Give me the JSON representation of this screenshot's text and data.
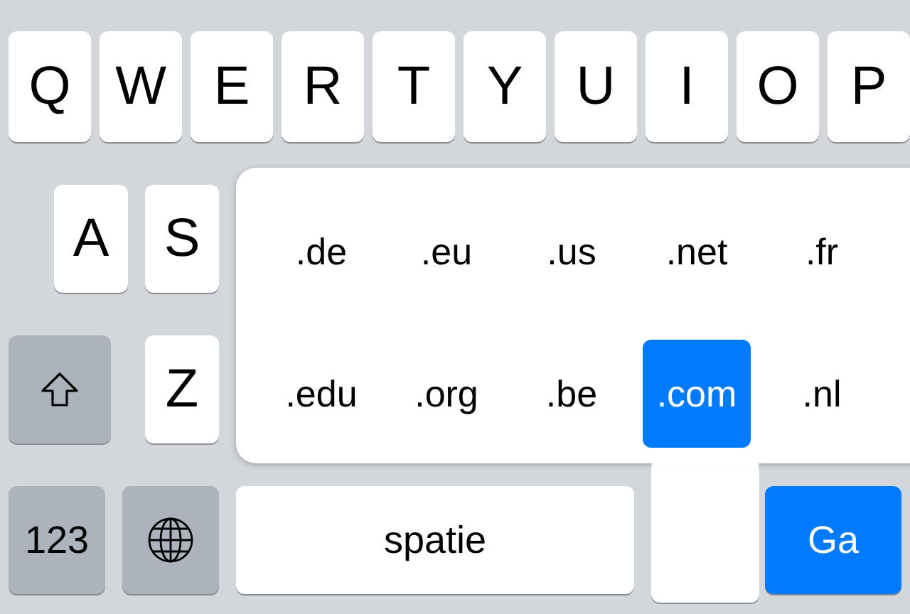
{
  "keyboard": {
    "rows": [
      {
        "keys": [
          {
            "kind": "letter",
            "label": "Q"
          },
          {
            "kind": "letter",
            "label": "W"
          },
          {
            "kind": "letter",
            "label": "E"
          },
          {
            "kind": "letter",
            "label": "R"
          },
          {
            "kind": "letter",
            "label": "T"
          },
          {
            "kind": "letter",
            "label": "Y"
          },
          {
            "kind": "letter",
            "label": "U"
          },
          {
            "kind": "letter",
            "label": "I"
          },
          {
            "kind": "letter",
            "label": "O"
          },
          {
            "kind": "letter",
            "label": "P"
          }
        ]
      },
      {
        "keys": [
          {
            "kind": "letter",
            "label": "A"
          },
          {
            "kind": "letter",
            "label": "S"
          }
        ]
      },
      {
        "keys": [
          {
            "kind": "shift"
          },
          {
            "kind": "letter",
            "label": "Z"
          }
        ]
      },
      {
        "keys": [
          {
            "kind": "numbers",
            "label": "123"
          },
          {
            "kind": "globe"
          },
          {
            "kind": "space",
            "label": "spatie"
          },
          {
            "kind": "go",
            "label": "Ga"
          }
        ]
      }
    ]
  },
  "domain_popup": {
    "items": [
      {
        "label": ".de",
        "selected": false
      },
      {
        "label": ".eu",
        "selected": false
      },
      {
        "label": ".us",
        "selected": false
      },
      {
        "label": ".net",
        "selected": false
      },
      {
        "label": ".fr",
        "selected": false
      },
      {
        "label": ".edu",
        "selected": false
      },
      {
        "label": ".org",
        "selected": false
      },
      {
        "label": ".be",
        "selected": false
      },
      {
        "label": ".com",
        "selected": true
      },
      {
        "label": ".nl",
        "selected": false
      }
    ]
  }
}
